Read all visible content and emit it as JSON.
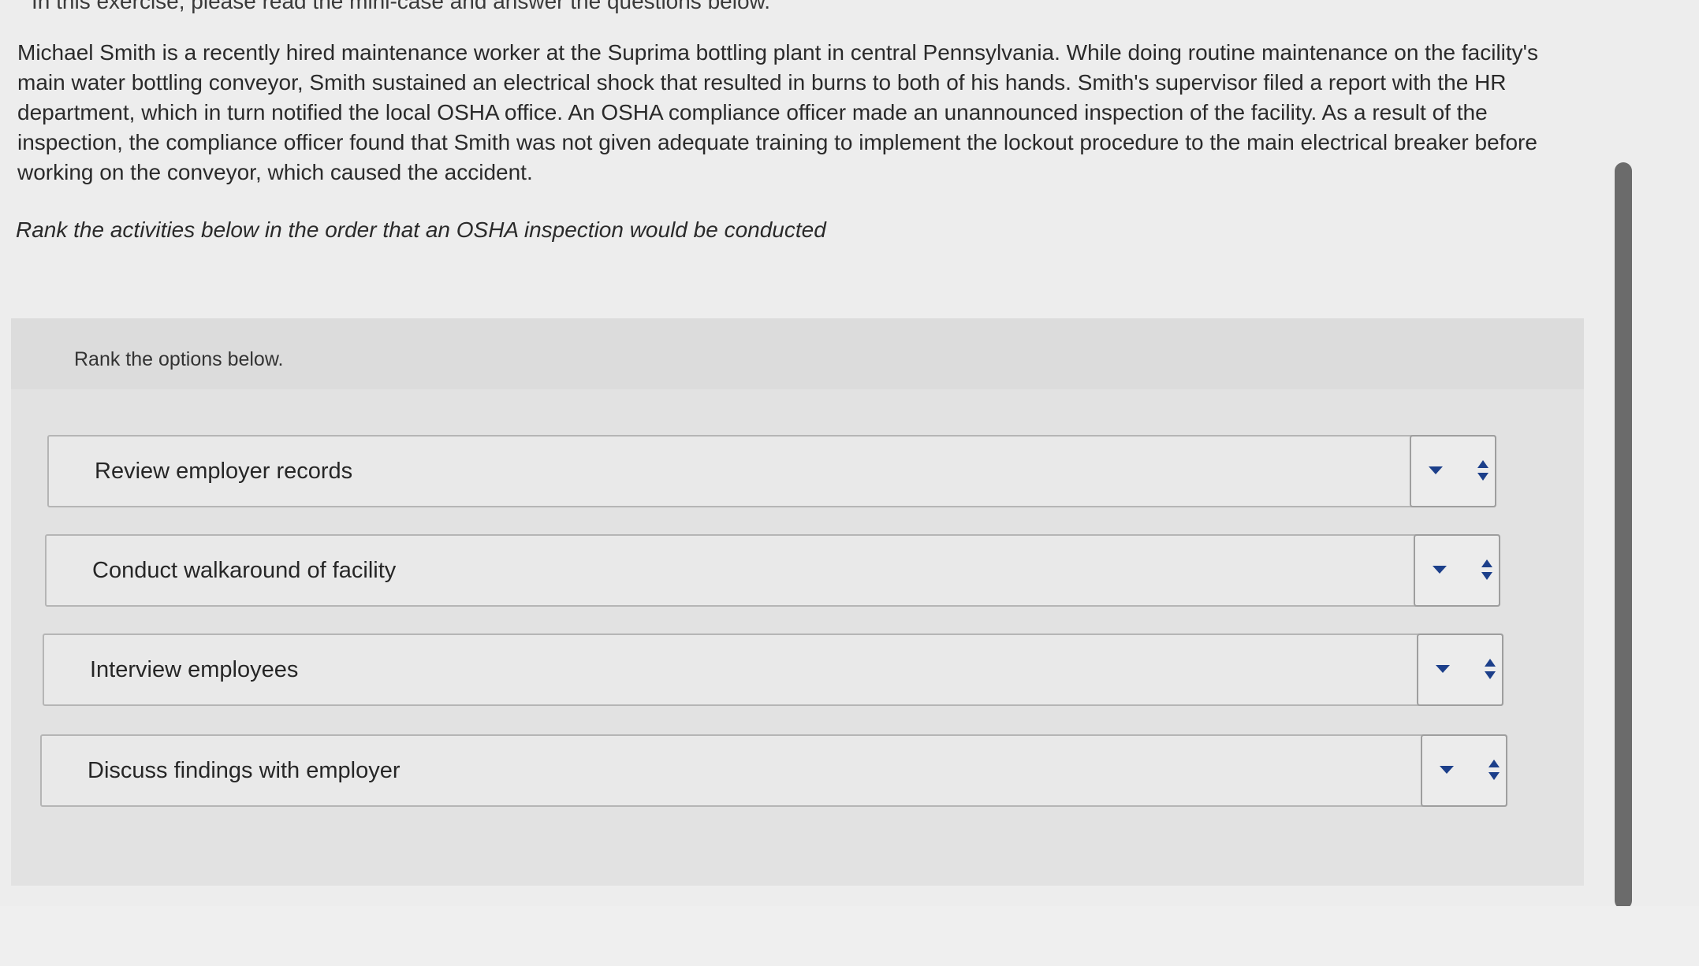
{
  "header": {
    "cut_off_text": "In this exercise, please read the mini-case and answer the questions below."
  },
  "passage": {
    "text": "Michael Smith is a recently hired maintenance worker at the Suprima bottling plant in central Pennsylvania. While doing routine maintenance on the facility's main water bottling conveyor, Smith sustained an electrical shock that resulted in burns to both of his hands. Smith's supervisor filed a report with the HR department, which in turn notified the local OSHA office. An OSHA compliance officer made an unannounced inspection of the facility. As a result of the inspection, the compliance officer found that Smith was not given adequate training to implement the lockout procedure to the main electrical breaker before working on the conveyor, which caused the accident."
  },
  "question": {
    "instruction": "Rank the activities below in the order that an OSHA inspection would be conducted"
  },
  "ranking": {
    "header_label": "Rank the options below.",
    "items": [
      {
        "label": "Review employer records",
        "dropdown_icon": "caret-down-icon",
        "reorder_icon": "up-down-arrows-icon"
      },
      {
        "label": "Conduct walkaround of facility",
        "dropdown_icon": "caret-down-icon",
        "reorder_icon": "up-down-arrows-icon"
      },
      {
        "label": "Interview employees",
        "dropdown_icon": "caret-down-icon",
        "reorder_icon": "up-down-arrows-icon"
      },
      {
        "label": "Discuss findings with employer",
        "dropdown_icon": "caret-down-icon",
        "reorder_icon": "up-down-arrows-icon"
      }
    ]
  },
  "colors": {
    "accent_icon": "#1c3f8a",
    "panel_background": "#e2e2e2",
    "page_background": "#ededed",
    "scrollbar_thumb": "#6b6b6b"
  }
}
